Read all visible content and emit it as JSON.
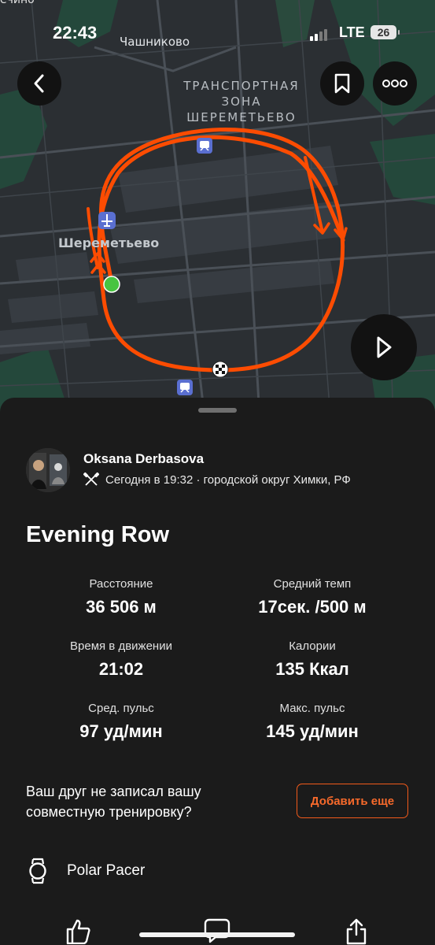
{
  "status_bar": {
    "time": "22:43",
    "network": "LTE",
    "battery": "26"
  },
  "map": {
    "labels": {
      "top_cut": "ечино",
      "village": "Чашниково",
      "zone": "ТРАНСПОРТНАЯ ЗОНА ШЕРЕМЕТЬЕВО",
      "airport": "Шереметьево"
    },
    "route_color": "#fc4c02",
    "start_color": "#47c441"
  },
  "activity": {
    "athlete": "Oksana Derbasova",
    "meta": "Сегодня в 19:32 · городской округ Химки, РФ",
    "title": "Evening Row",
    "stats": [
      {
        "label": "Расстояние",
        "value": "36 506 м"
      },
      {
        "label": "Средний темп",
        "value": "17сек. /500 м"
      },
      {
        "label": "Время в движении",
        "value": "21:02"
      },
      {
        "label": "Калории",
        "value": "135 Ккал"
      },
      {
        "label": "Сред. пульс",
        "value": "97 уд/мин"
      },
      {
        "label": "Макс. пульс",
        "value": "145 уд/мин"
      }
    ]
  },
  "friend_prompt": {
    "text": "Ваш друг не записал вашу совместную тренировку?",
    "button": "Добавить еще"
  },
  "device": "Polar Pacer",
  "accent_color": "#f25a1b"
}
